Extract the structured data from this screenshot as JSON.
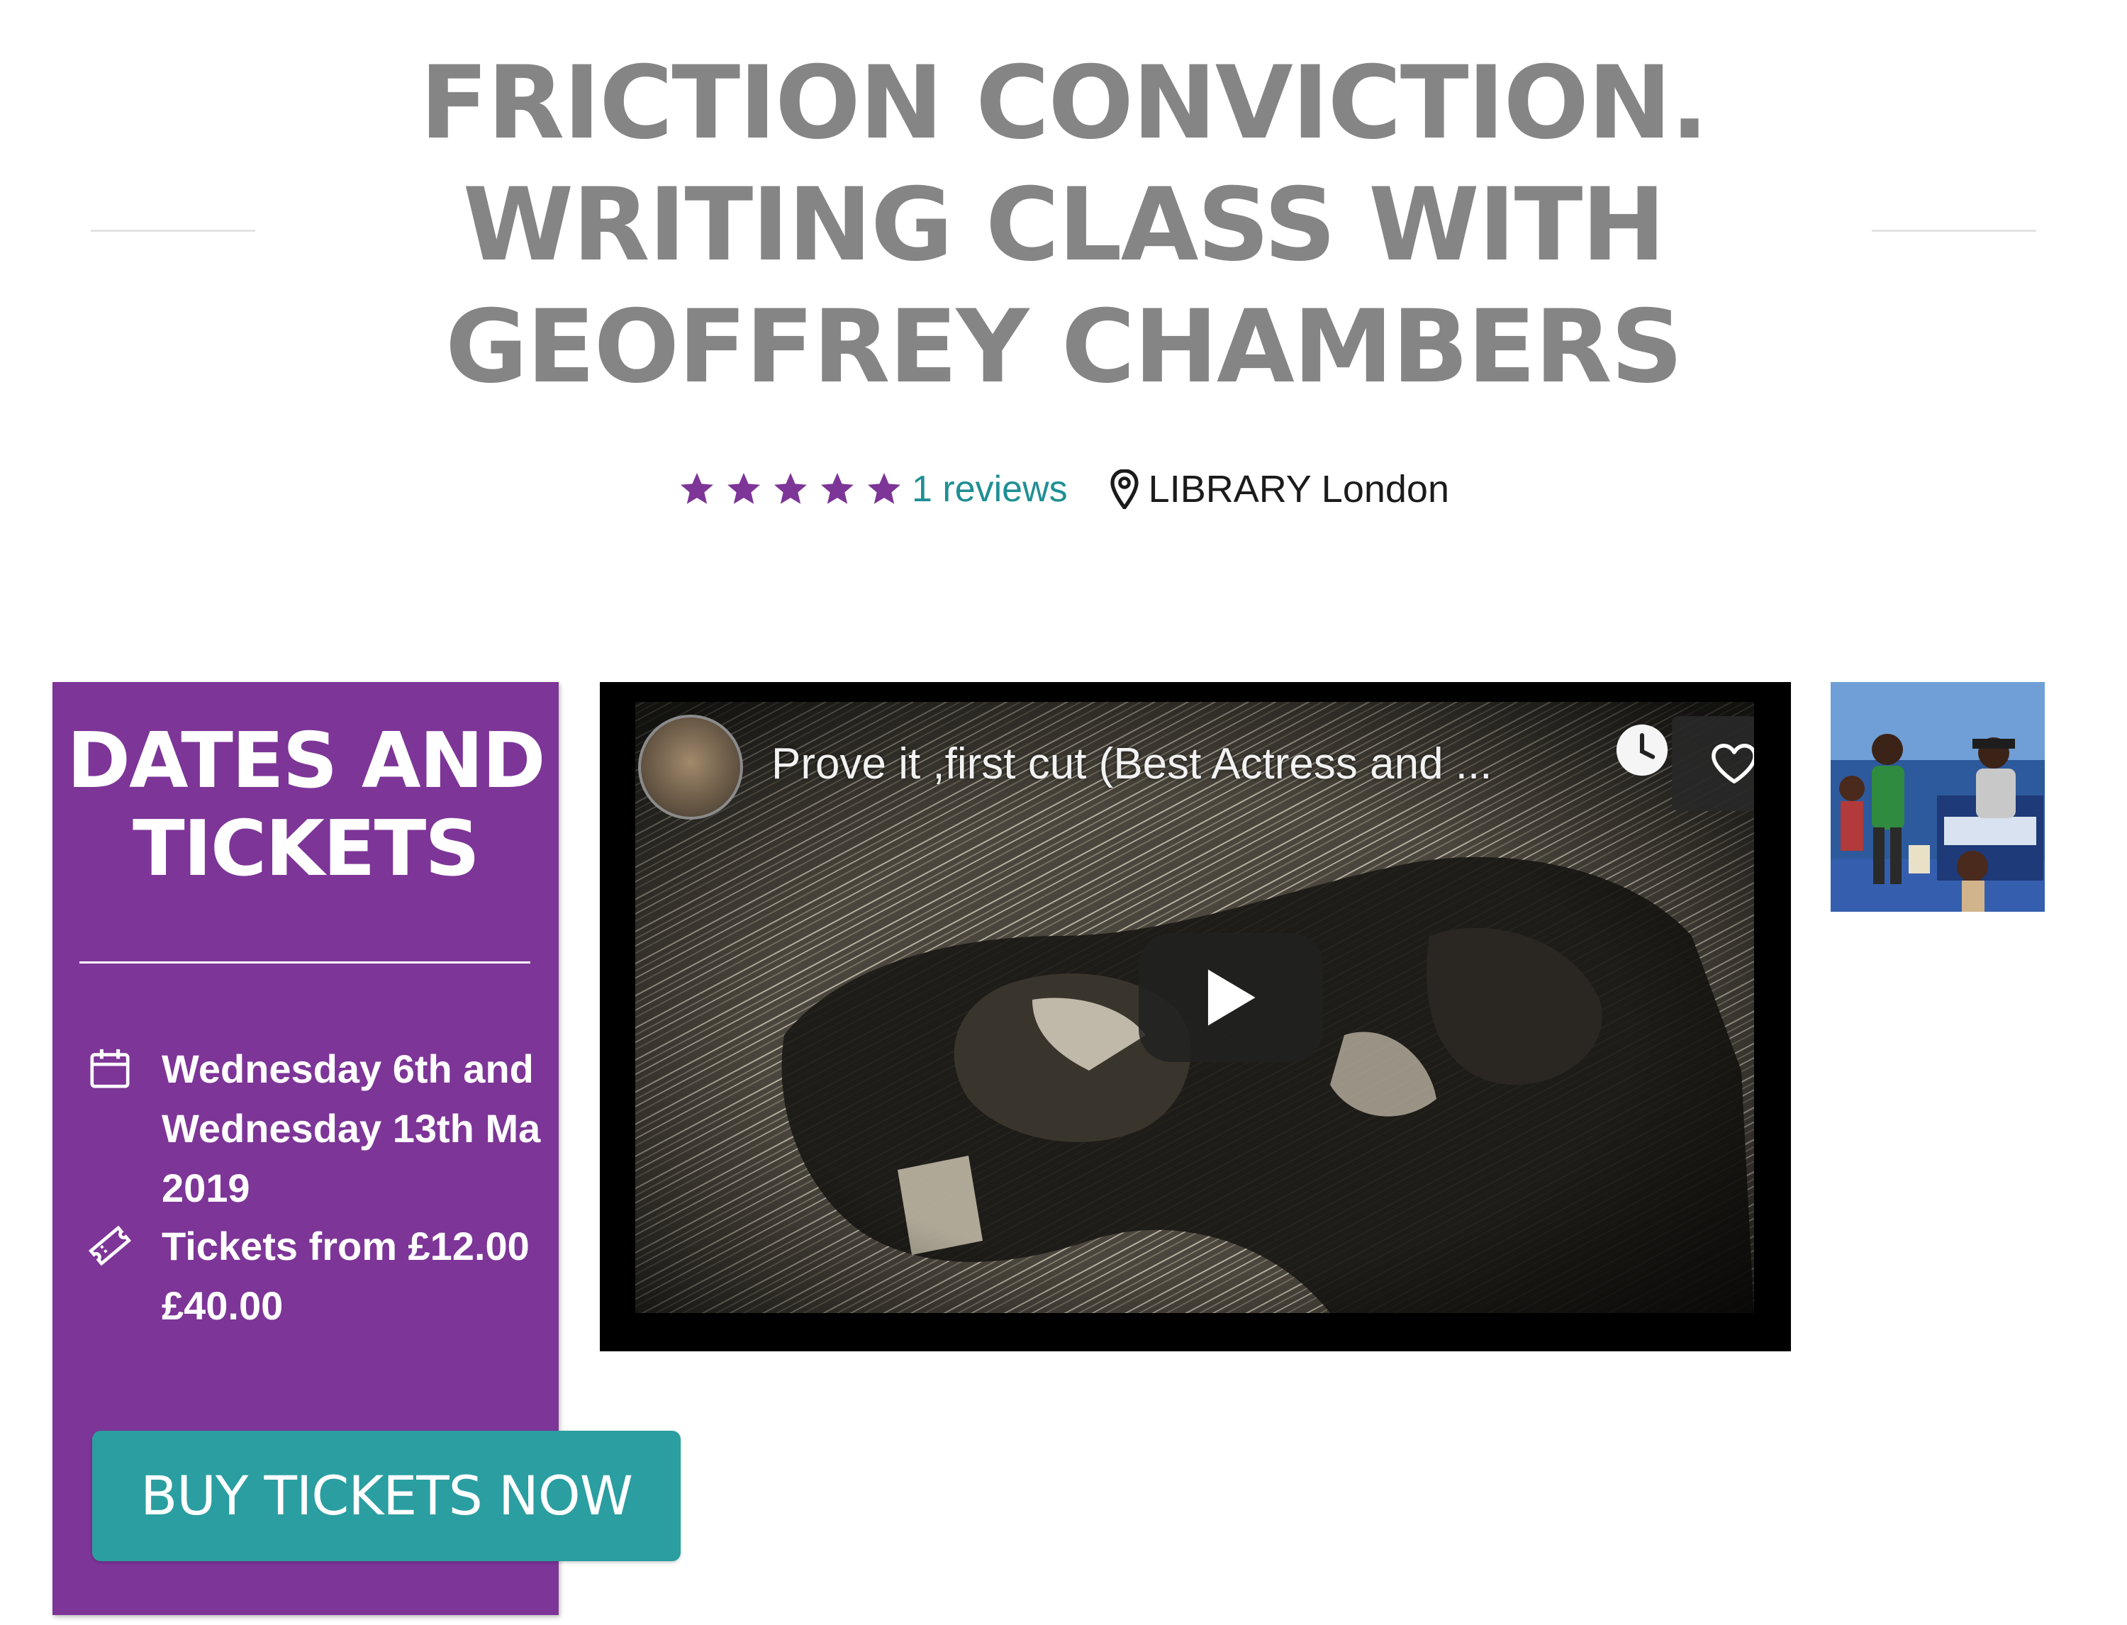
{
  "event": {
    "title_lines": [
      "FRICTION CONVICTION.",
      "WRITING CLASS WITH",
      "GEOFFREY CHAMBERS"
    ],
    "rating": 5,
    "rating_max": 5,
    "reviews_label": "1 reviews",
    "location": "LIBRARY London"
  },
  "tickets_panel": {
    "heading_lines": [
      "DATES AND",
      "TICKETS"
    ],
    "dates_text": "Wednesday 6th and\nWednesday 13th Ma\n2019",
    "price_text": "Tickets from £12.00\n£40.00",
    "buy_button_label": "BUY TICKETS NOW"
  },
  "video": {
    "title": "Prove it ,first cut (Best Actress and ..."
  },
  "icons": {
    "star": "star-icon",
    "location": "map-pin-icon",
    "calendar": "calendar-icon",
    "ticket": "ticket-icon",
    "watch_later": "clock-icon",
    "favorite": "heart-icon",
    "play": "play-icon"
  },
  "colors": {
    "title": "#858585",
    "star": "#7d3597",
    "reviews_link": "#1f8f94",
    "panel_bg": "#7d3597",
    "button_bg": "#2a9ea0"
  }
}
